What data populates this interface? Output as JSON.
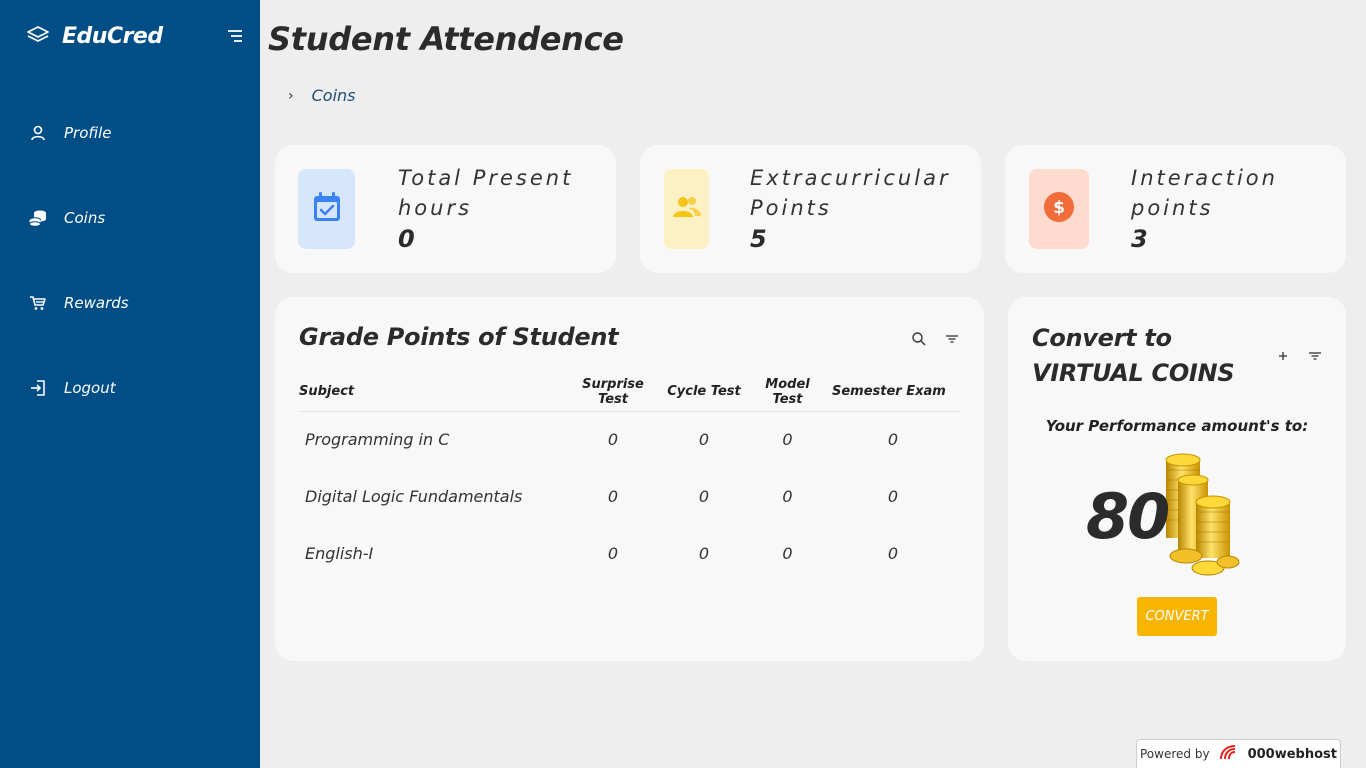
{
  "app": {
    "brand": "EduCred"
  },
  "sidebar": {
    "items": [
      {
        "label": "Profile",
        "icon": "user-icon"
      },
      {
        "label": "Coins",
        "icon": "coins-icon"
      },
      {
        "label": "Rewards",
        "icon": "cart-icon"
      },
      {
        "label": "Logout",
        "icon": "logout-icon"
      }
    ]
  },
  "page": {
    "title": "Student Attendence",
    "breadcrumb": "Coins"
  },
  "stats": [
    {
      "label": "Total Present hours",
      "value": "0",
      "icon": "calendar-check-icon",
      "color": "#3b82f6",
      "bg": "#d6e6fb"
    },
    {
      "label": "Extracurricular Points",
      "value": "5",
      "icon": "people-icon",
      "color": "#f5c518",
      "bg": "#fdf0c2"
    },
    {
      "label": "Interaction points",
      "value": "3",
      "icon": "dollar-icon",
      "color": "#f26b3a",
      "bg": "#fddccf"
    }
  ],
  "grades": {
    "title": "Grade Points of Student",
    "columns": [
      "Subject",
      "Surprise Test",
      "Cycle Test",
      "Model Test",
      "Semester Exam"
    ],
    "rows": [
      {
        "subject": "Programming in C",
        "surprise": "0",
        "cycle": "0",
        "model": "0",
        "semester": "0"
      },
      {
        "subject": "Digital Logic Fundamentals",
        "surprise": "0",
        "cycle": "0",
        "model": "0",
        "semester": "0"
      },
      {
        "subject": "English-I",
        "surprise": "0",
        "cycle": "0",
        "model": "0",
        "semester": "0"
      }
    ]
  },
  "convert": {
    "title": "Convert to VIRTUAL COINS",
    "performance_text": "Your Performance amount's to:",
    "amount": "80",
    "button_label": "CONVERT"
  },
  "footer": {
    "powered_by": "Powered by",
    "host": "000webhost"
  },
  "colors": {
    "sidebar": "#004e85",
    "accent": "#f7b500"
  }
}
